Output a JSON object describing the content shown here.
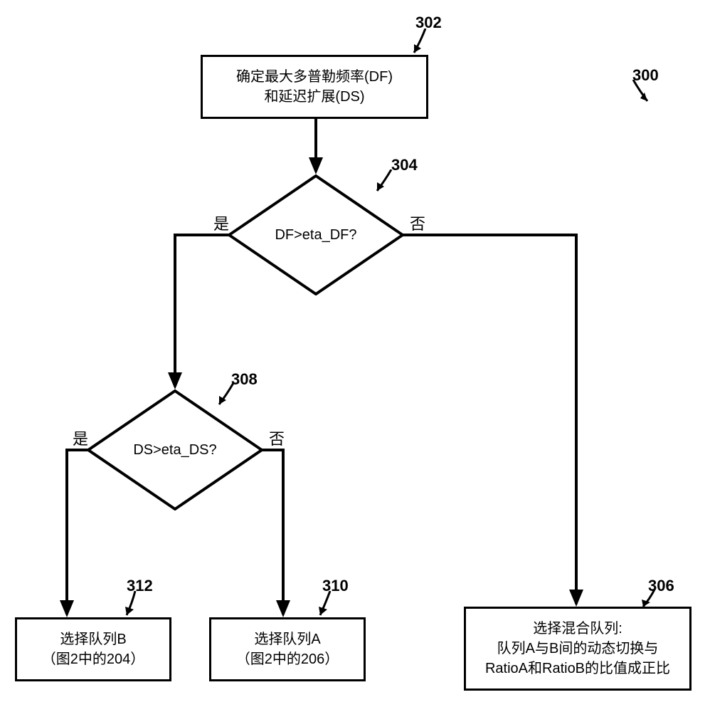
{
  "figure_label": "300",
  "nodes": {
    "302": {
      "label": "302",
      "line1": "确定最大多普勒频率(DF)",
      "line2": "和延迟扩展(DS)"
    },
    "304": {
      "label": "304",
      "text": "DF>eta_DF?",
      "yes": "是",
      "no": "否"
    },
    "308": {
      "label": "308",
      "text": "DS>eta_DS?",
      "yes": "是",
      "no": "否"
    },
    "312": {
      "label": "312",
      "line1": "选择队列B",
      "line2": "（图2中的204）"
    },
    "310": {
      "label": "310",
      "line1": "选择队列A",
      "line2": "（图2中的206）"
    },
    "306": {
      "label": "306",
      "line1": "选择混合队列:",
      "line2": "队列A与B间的动态切换与",
      "line3": "RatioA和RatioB的比值成正比"
    }
  }
}
